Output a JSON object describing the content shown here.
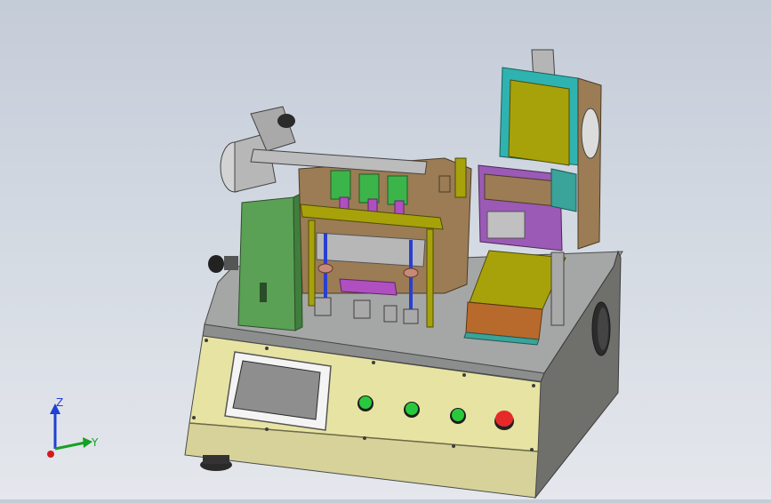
{
  "viewport": {
    "background_top": "#c4ccd8",
    "background_bottom": "#e4e7ec"
  },
  "model": {
    "colors": {
      "base_front": "#e7e3a3",
      "base_side": "#6f706c",
      "base_top": "#a5a7a6",
      "green_column": "#5aa055",
      "olive_panel": "#a7a20a",
      "brown_plate": "#9b7c55",
      "magenta_parts": "#b04fc0",
      "purple_blocks": "#9b5ab5",
      "cyan_frame": "#2fb3b0",
      "teal_parts": "#3aa39a",
      "screen_bezel": "#f4f4f4",
      "screen": "#8e8e8e",
      "button_green": "#29c93d",
      "button_red": "#e62a2a",
      "dark_metal": "#2f2f2f"
    },
    "buttons": [
      "start-1",
      "start-2",
      "start-3",
      "emergency-stop"
    ]
  },
  "triad": {
    "z_label": "Z",
    "y_label": "Y",
    "z_color": "#1f3fd6",
    "y_color": "#16a024",
    "x_color": "#d01c1c"
  }
}
